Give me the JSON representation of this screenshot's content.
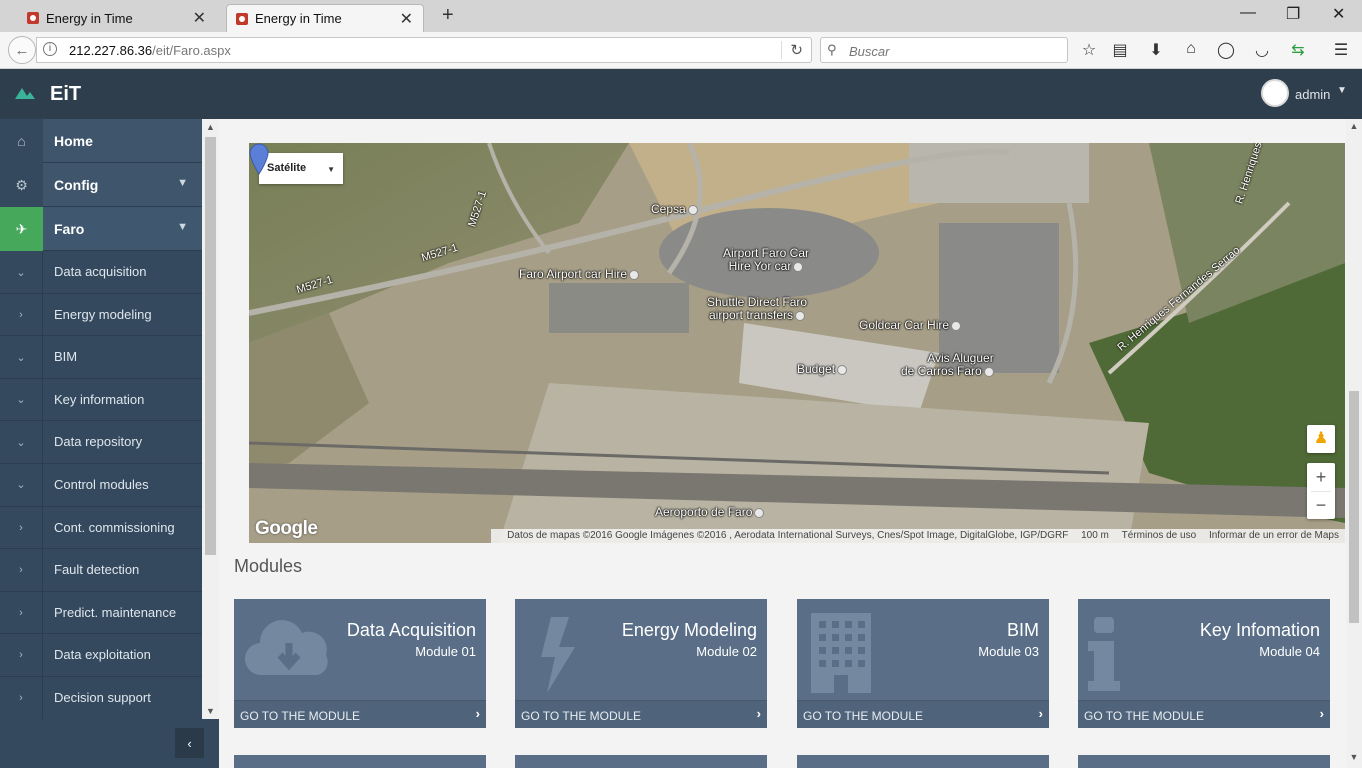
{
  "browser": {
    "tabs": [
      {
        "title": "Energy in Time",
        "active": false
      },
      {
        "title": "Energy in Time",
        "active": true
      }
    ],
    "url_host": "212.227.86.36",
    "url_path": "/eit/Faro.aspx",
    "search_placeholder": "Buscar"
  },
  "header": {
    "app_title": "EiT",
    "user_name": "admin",
    "brand_color": "#2f3e4c",
    "accent_color": "#46a85b"
  },
  "sidebar": {
    "main_items": [
      {
        "label": "Home",
        "icon": "home-icon"
      },
      {
        "label": "Config",
        "icon": "gear-icon"
      },
      {
        "label": "Faro",
        "icon": "airplane-icon"
      }
    ],
    "sub_items": [
      {
        "label": "Data acquisition",
        "expanded": true
      },
      {
        "label": "Energy modeling",
        "expanded": false
      },
      {
        "label": "BIM",
        "expanded": true
      },
      {
        "label": "Key information",
        "expanded": true
      },
      {
        "label": "Data repository",
        "expanded": true
      },
      {
        "label": "Control modules",
        "expanded": true
      },
      {
        "label": "Cont. commissioning",
        "expanded": false
      },
      {
        "label": "Fault detection",
        "expanded": false
      },
      {
        "label": "Predict. maintenance",
        "expanded": false
      },
      {
        "label": "Data exploitation",
        "expanded": false
      },
      {
        "label": "Decision support",
        "expanded": false
      }
    ]
  },
  "map": {
    "type_selected": "Satélite",
    "labels": {
      "cepsa": "Cepsa",
      "faro_car_hire": "Faro Airport car Hire",
      "airport_faro_car_1": "Airport Faro Car",
      "airport_faro_car_2": "Hire Yor car",
      "shuttle_1": "Shuttle Direct Faro",
      "shuttle_2": "airport transfers",
      "goldcar": "Goldcar Car Hire",
      "avis_1": "Avis Aluguer",
      "avis_2": "de Carros Faro",
      "budget": "Budget",
      "aeroporto": "Aeroporto de Faro",
      "road_m527_a": "M527-1",
      "road_m527_b": "M527-1",
      "road_m527_c": "M527-1",
      "road_henriques_1": "R. Henriques",
      "road_henriques_2": "R. Henriques Fernandes Serrao"
    },
    "google": "Google",
    "attribution": "Datos de mapas ©2016 Google Imágenes ©2016 , Aerodata International Surveys, Cnes/Spot Image, DigitalGlobe, IGP/DGRF",
    "scale": "100 m",
    "terms": "Términos de uso",
    "report": "Informar de un error de Maps"
  },
  "modules": {
    "title": "Modules",
    "go_label": "GO TO THE MODULE",
    "items": [
      {
        "title": "Data Acquisition",
        "sub": "Module 01",
        "icon": "cloud-download-icon"
      },
      {
        "title": "Energy Modeling",
        "sub": "Module 02",
        "icon": "lightning-icon"
      },
      {
        "title": "BIM",
        "sub": "Module 03",
        "icon": "building-icon"
      },
      {
        "title": "Key Infomation",
        "sub": "Module 04",
        "icon": "info-icon"
      }
    ]
  }
}
